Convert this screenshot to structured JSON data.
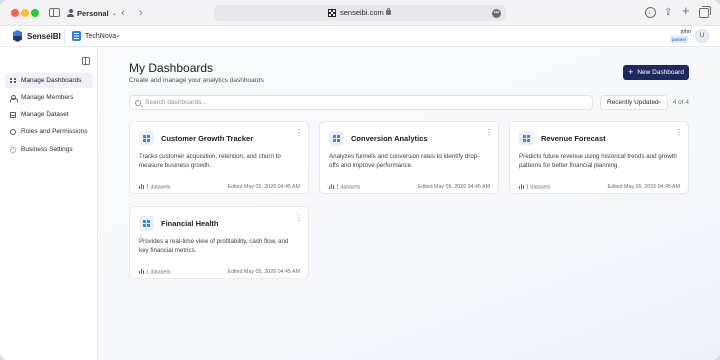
{
  "browser": {
    "profile_label": "Personal",
    "url": "senseibi.com"
  },
  "app": {
    "brand": "SenseiBI",
    "org_name": "TechNova",
    "user_name": "john",
    "user_role": "partner",
    "user_initial": "U"
  },
  "sidebar": {
    "items": [
      {
        "label": "Manage Dashboards",
        "icon": "grid-icon",
        "active": true
      },
      {
        "label": "Manage Members",
        "icon": "members-icon",
        "active": false
      },
      {
        "label": "Manage Dataset",
        "icon": "dataset-icon",
        "active": false
      },
      {
        "label": "Roles and Permissions",
        "icon": "shield-icon",
        "active": false
      },
      {
        "label": "Business Settings",
        "icon": "gear-icon",
        "active": false
      }
    ]
  },
  "main": {
    "title": "My Dashboards",
    "subtitle": "Create and manage your analytics dashboards",
    "new_button_label": "New Dashboard",
    "search_placeholder": "Search dashboards...",
    "sort_value": "Recently Updated",
    "count_text": "4 of 4",
    "cards": [
      {
        "title": "Customer Growth Tracker",
        "description": "Tracks customer acquisition, retention, and churn to measure business growth.",
        "datasets": "1 datasets",
        "edited": "Edited May 05, 2026 04:45 AM"
      },
      {
        "title": "Conversion Analytics",
        "description": "Analyzes funnels and conversion rates to identify drop-offs and improve performance.",
        "datasets": "1 datasets",
        "edited": "Edited May 05, 2026 04:45 AM"
      },
      {
        "title": "Revenue Forecast",
        "description": "Predicts future revenue using historical trends and growth patterns for better financial planning.",
        "datasets": "1 datasets",
        "edited": "Edited May 05, 2026 04:45 AM"
      },
      {
        "title": "Financial Health",
        "description": "Provides a real-time view of profitability, cash flow, and key financial metrics.",
        "datasets": "1 datasets",
        "edited": "Edited May 05, 2026 04:45 AM"
      }
    ]
  },
  "colors": {
    "primary_button": "#1e2a5e",
    "accent": "#3b82f6",
    "active_nav_bg": "#eef1f7"
  }
}
